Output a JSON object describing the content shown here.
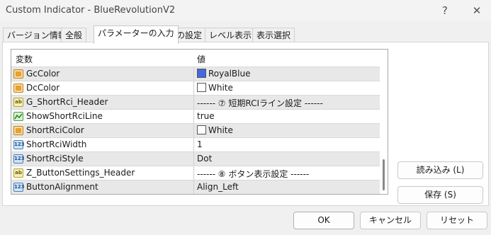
{
  "window": {
    "title": "Custom Indicator - BlueRevolutionV2",
    "help_label": "?",
    "close_label": "✕"
  },
  "tabs": [
    {
      "label": "バージョン情報"
    },
    {
      "label": "全般"
    },
    {
      "label": "パラメーターの入力"
    },
    {
      "label": "色の設定"
    },
    {
      "label": "レベル表示"
    },
    {
      "label": "表示選択"
    }
  ],
  "grid": {
    "header_name": "変数",
    "header_value": "値",
    "rows": [
      {
        "type": "color",
        "name": "GcColor",
        "value": "RoyalBlue",
        "swatch": "#4169e1"
      },
      {
        "type": "color",
        "name": "DcColor",
        "value": "White",
        "swatch": "#ffffff"
      },
      {
        "type": "str",
        "name": "G_ShortRci_Header",
        "value": "------ ⑦ 短期RCIライン設定 ------"
      },
      {
        "type": "line",
        "name": "ShowShortRciLine",
        "value": "true"
      },
      {
        "type": "color",
        "name": "ShortRciColor",
        "value": "White",
        "swatch": "#ffffff"
      },
      {
        "type": "int",
        "name": "ShortRciWidth",
        "value": "1"
      },
      {
        "type": "int",
        "name": "ShortRciStyle",
        "value": "Dot"
      },
      {
        "type": "str",
        "name": "Z_ButtonSettings_Header",
        "value": "------ ⑧ ボタン表示設定 ------"
      },
      {
        "type": "int",
        "name": "ButtonAlignment",
        "value": "Align_Left"
      }
    ]
  },
  "side_buttons": {
    "load_label": "読み込み (L)",
    "save_label": "保存 (S)"
  },
  "footer": {
    "ok_label": "OK",
    "cancel_label": "キャンセル",
    "reset_label": "リセット"
  },
  "icon_text": {
    "int": "123",
    "str": "ab"
  }
}
